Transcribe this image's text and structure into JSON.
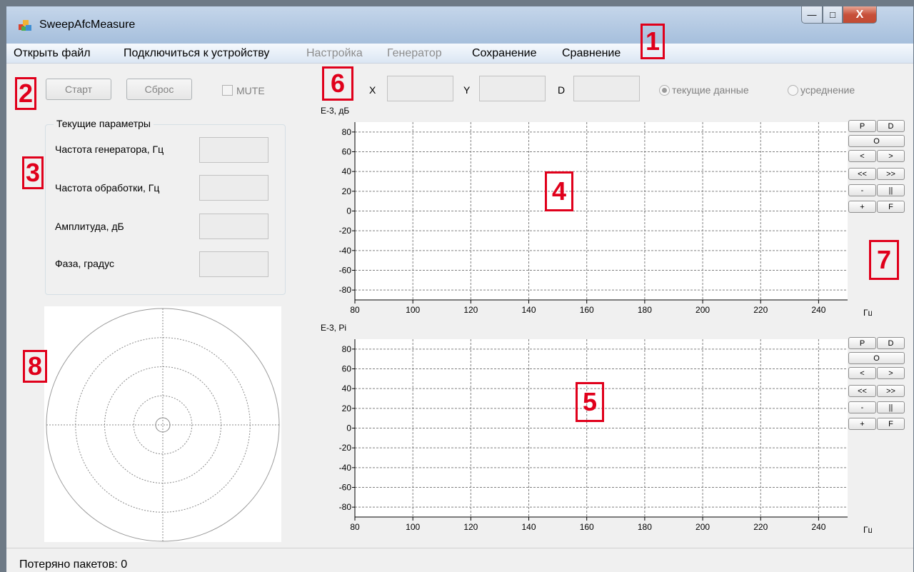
{
  "window": {
    "title": "SweepAfcMeasure",
    "min_label": "—",
    "max_label": "□",
    "close_label": "X"
  },
  "menu": [
    {
      "label": "Открыть файл",
      "enabled": true
    },
    {
      "label": "Подключиться к устройству",
      "enabled": true
    },
    {
      "label": "Настройка",
      "enabled": false
    },
    {
      "label": "Генератор",
      "enabled": false
    },
    {
      "label": "Сохранение",
      "enabled": true
    },
    {
      "label": "Сравнение",
      "enabled": true
    }
  ],
  "toolbar": {
    "start_label": "Старт",
    "reset_label": "Сброс",
    "mute_label": "MUTE",
    "mute_checked": false,
    "x_label": "X",
    "x_value": "",
    "y_label": "Y",
    "y_value": "",
    "d_label": "D",
    "d_value": "",
    "radio_current_label": "текущие данные",
    "radio_avg_label": "усреднение",
    "selected_radio": "current"
  },
  "params": {
    "group_title": "Текущие параметры",
    "fields": [
      {
        "label": "Частота генератора, Гц",
        "value": ""
      },
      {
        "label": "Частота обработки, Гц",
        "value": ""
      },
      {
        "label": "Амплитуда, дБ",
        "value": ""
      },
      {
        "label": "Фаза, градус",
        "value": ""
      }
    ]
  },
  "annotations": [
    "1",
    "2",
    "3",
    "4",
    "5",
    "6",
    "7",
    "8"
  ],
  "side_buttons": {
    "p": "P",
    "d": "D",
    "o": "O",
    "left": "<",
    "right": ">",
    "left2": "<<",
    "right2": ">>",
    "minus": "-",
    "pause": "||",
    "plus": "+",
    "f": "F"
  },
  "chart_data": [
    {
      "type": "line",
      "title": "",
      "ylabel": "E-3, дБ",
      "xlabel": "Гц",
      "x_ticks": [
        80,
        100,
        120,
        140,
        160,
        180,
        200,
        220,
        240
      ],
      "y_ticks": [
        80,
        60,
        40,
        20,
        0,
        -20,
        -40,
        -60,
        -80
      ],
      "xlim": [
        80,
        250
      ],
      "ylim": [
        -90,
        90
      ],
      "grid": true,
      "series": []
    },
    {
      "type": "line",
      "title": "",
      "ylabel": "E-3, Pi",
      "xlabel": "Гц",
      "x_ticks": [
        80,
        100,
        120,
        140,
        160,
        180,
        200,
        220,
        240
      ],
      "y_ticks": [
        80,
        60,
        40,
        20,
        0,
        -20,
        -40,
        -60,
        -80
      ],
      "xlim": [
        80,
        250
      ],
      "ylim": [
        -90,
        90
      ],
      "grid": true,
      "series": []
    }
  ],
  "polar": {
    "type": "polar",
    "rings": 4,
    "series": []
  },
  "status": {
    "text": "Потеряно пакетов: 0"
  }
}
